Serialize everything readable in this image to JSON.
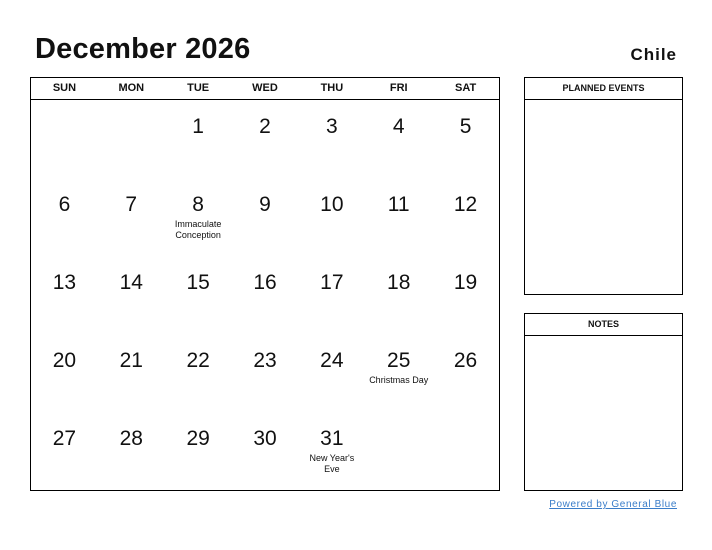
{
  "header": {
    "title": "December 2026",
    "country": "Chile"
  },
  "weekdays": [
    "SUN",
    "MON",
    "TUE",
    "WED",
    "THU",
    "FRI",
    "SAT"
  ],
  "weeks": [
    [
      {
        "day": ""
      },
      {
        "day": ""
      },
      {
        "day": "1"
      },
      {
        "day": "2"
      },
      {
        "day": "3"
      },
      {
        "day": "4"
      },
      {
        "day": "5"
      }
    ],
    [
      {
        "day": "6"
      },
      {
        "day": "7"
      },
      {
        "day": "8",
        "holiday": "Immaculate Conception"
      },
      {
        "day": "9"
      },
      {
        "day": "10"
      },
      {
        "day": "11"
      },
      {
        "day": "12"
      }
    ],
    [
      {
        "day": "13"
      },
      {
        "day": "14"
      },
      {
        "day": "15"
      },
      {
        "day": "16"
      },
      {
        "day": "17"
      },
      {
        "day": "18"
      },
      {
        "day": "19"
      }
    ],
    [
      {
        "day": "20"
      },
      {
        "day": "21"
      },
      {
        "day": "22"
      },
      {
        "day": "23"
      },
      {
        "day": "24"
      },
      {
        "day": "25",
        "holiday": "Christmas Day"
      },
      {
        "day": "26"
      }
    ],
    [
      {
        "day": "27"
      },
      {
        "day": "28"
      },
      {
        "day": "29"
      },
      {
        "day": "30"
      },
      {
        "day": "31",
        "holiday": "New Year's Eve"
      },
      {
        "day": ""
      },
      {
        "day": ""
      }
    ]
  ],
  "panels": {
    "planned_events": "PLANNED EVENTS",
    "notes": "NOTES"
  },
  "footer": {
    "powered_by": "Powered by General Blue",
    "link_color": "#3a7dc9"
  }
}
